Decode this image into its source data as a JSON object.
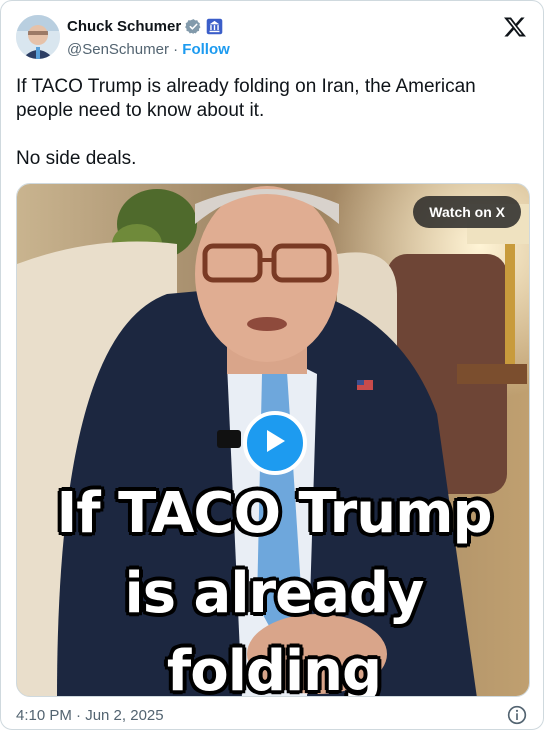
{
  "author": {
    "display_name": "Chuck Schumer",
    "handle": "@SenSchumer",
    "separator": " · ",
    "follow_label": "Follow",
    "verified_badge_color": "#829aab",
    "affiliation_badge_color": "#3b5ec9"
  },
  "tweet": {
    "paragraphs": [
      "If TACO Trump is already folding on Iran, the American people need to know about it.",
      "No side deals."
    ],
    "timestamp": "4:10 PM · Jun 2, 2025"
  },
  "media": {
    "watch_label": "Watch on X",
    "caption_lines": [
      "If TACO Trump",
      "is already",
      "folding"
    ],
    "play_color": "#1d9bf0"
  },
  "icons": {
    "platform_logo": "x-logo-icon",
    "verified": "verified-badge-icon",
    "affiliation": "government-affiliation-icon",
    "info": "info-icon",
    "play": "play-icon"
  }
}
